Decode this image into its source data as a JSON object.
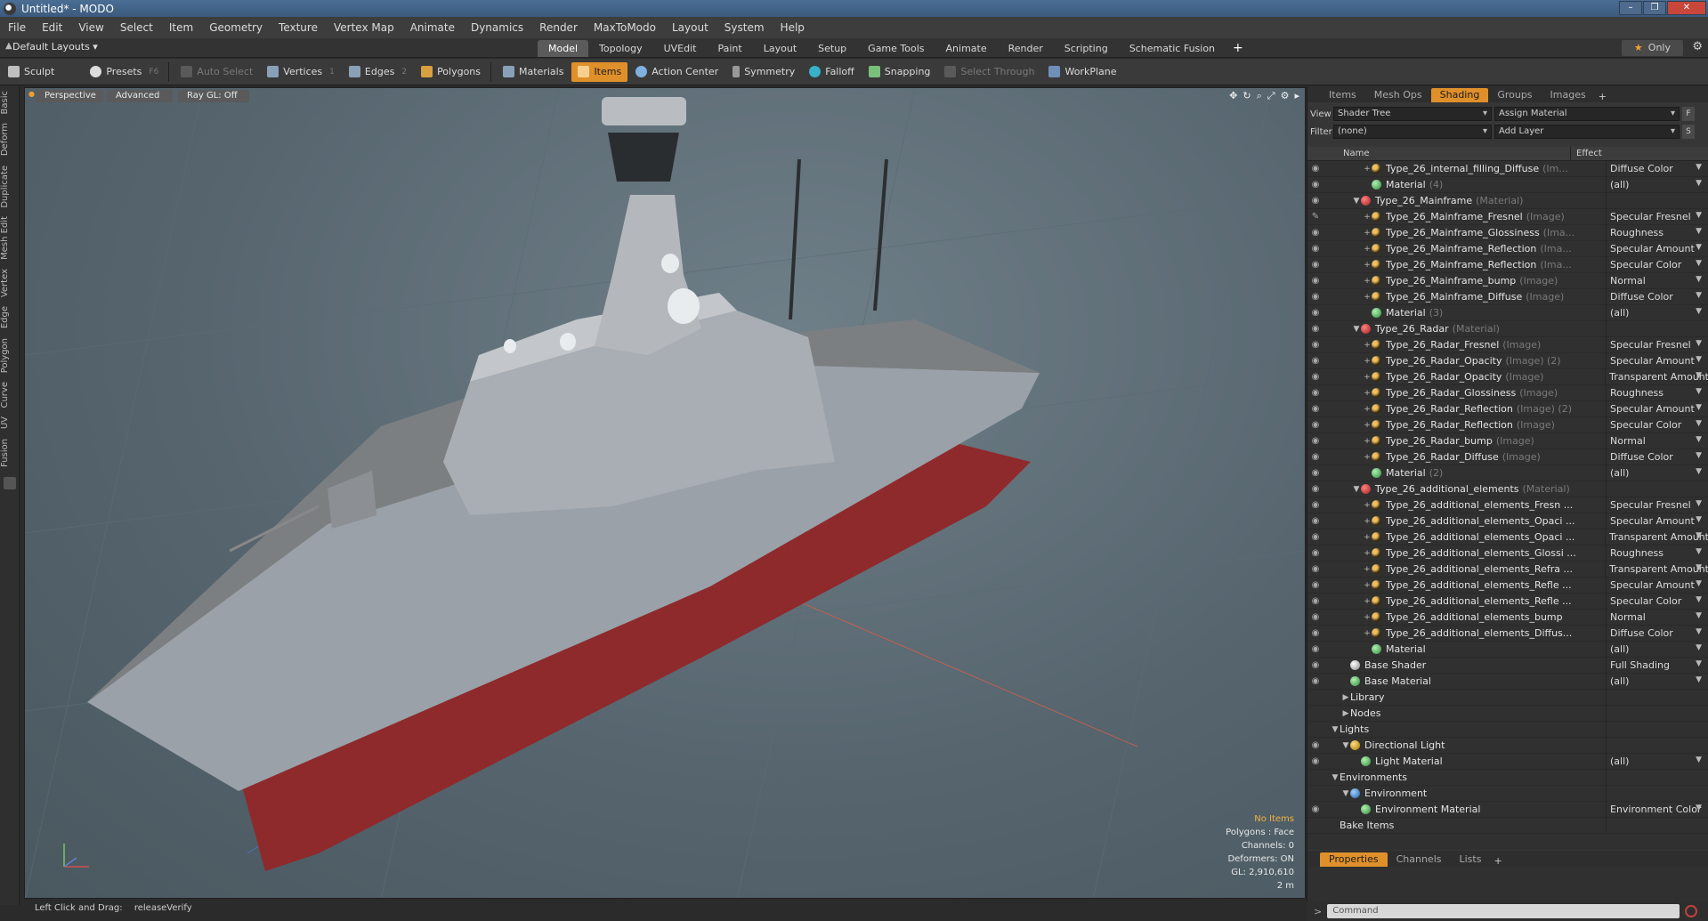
{
  "window": {
    "title": "Untitled* - MODO",
    "buttons": [
      "–",
      "❐",
      "✕"
    ]
  },
  "menu": [
    "File",
    "Edit",
    "View",
    "Select",
    "Item",
    "Geometry",
    "Texture",
    "Vertex Map",
    "Animate",
    "Dynamics",
    "Render",
    "MaxToModo",
    "Layout",
    "System",
    "Help"
  ],
  "layouts": {
    "selector": "Default Layouts ▾",
    "tabs": [
      "Model",
      "Topology",
      "UVEdit",
      "Paint",
      "Layout",
      "Setup",
      "Game Tools",
      "Animate",
      "Render",
      "Scripting",
      "Schematic Fusion"
    ],
    "active_tab": "Model",
    "only_label": "Only"
  },
  "toolbar": {
    "sculpt": "Sculpt",
    "presets": "Presets",
    "presets_key": "F6",
    "auto_select": "Auto Select",
    "vertices": "Vertices",
    "vertices_key": "1",
    "edges": "Edges",
    "edges_key": "2",
    "polygons": "Polygons",
    "materials": "Materials",
    "items": "Items",
    "action_center": "Action Center",
    "symmetry": "Symmetry",
    "falloff": "Falloff",
    "snapping": "Snapping",
    "select_through": "Select Through",
    "workplane": "WorkPlane"
  },
  "left_tabs": [
    "Basic",
    "Deform",
    "Duplicate",
    "Mesh Edit",
    "Vertex",
    "Edge",
    "Polygon",
    "Curve",
    "UV",
    "Fusion"
  ],
  "viewport": {
    "view": "Perspective",
    "shading": "Advanced",
    "raygl": "Ray GL: Off",
    "stats": {
      "items": "No Items",
      "polygons": "Polygons : Face",
      "channels": "Channels: 0",
      "deformers": "Deformers: ON",
      "gl": "GL: 2,910,610",
      "scale": "2 m"
    }
  },
  "status": {
    "hint": "Left Click and Drag:",
    "action": "releaseVerify"
  },
  "panel": {
    "tabs": [
      "Items",
      "Mesh Ops",
      "Shading",
      "Groups",
      "Images"
    ],
    "active_tab": "Shading",
    "view_label": "View",
    "view_value": "Shader Tree",
    "assign_material": "Assign Material",
    "filter_label": "Filter",
    "filter_value": "(none)",
    "add_layer": "Add Layer",
    "col_name": "Name",
    "col_effect": "Effect",
    "rows": [
      {
        "indent": 3,
        "exp": "+",
        "icon": "img",
        "name": "Type_26_internal_filling_Diffuse",
        "type": "(Im...",
        "effect": "Diffuse Color",
        "eye": true
      },
      {
        "indent": 3,
        "exp": "",
        "icon": "mat",
        "name": "Material",
        "type": "(4)",
        "effect": "(all)",
        "eye": true
      },
      {
        "indent": 2,
        "exp": "▼",
        "icon": "mask",
        "name": "Type_26_Mainframe",
        "type": "(Material)",
        "effect": "",
        "eye": true
      },
      {
        "indent": 3,
        "exp": "+",
        "icon": "img",
        "name": "Type_26_Mainframe_Fresnel",
        "type": "(Image)",
        "effect": "Specular Fresnel",
        "eye": true,
        "brush": true
      },
      {
        "indent": 3,
        "exp": "+",
        "icon": "img",
        "name": "Type_26_Mainframe_Glossiness",
        "type": "(Ima...",
        "effect": "Roughness",
        "eye": true
      },
      {
        "indent": 3,
        "exp": "+",
        "icon": "img",
        "name": "Type_26_Mainframe_Reflection",
        "type": "(Ima...",
        "effect": "Specular Amount",
        "eye": true
      },
      {
        "indent": 3,
        "exp": "+",
        "icon": "img",
        "name": "Type_26_Mainframe_Reflection",
        "type": "(Ima...",
        "effect": "Specular Color",
        "eye": true
      },
      {
        "indent": 3,
        "exp": "+",
        "icon": "img",
        "name": "Type_26_Mainframe_bump",
        "type": "(Image)",
        "effect": "Normal",
        "eye": true
      },
      {
        "indent": 3,
        "exp": "+",
        "icon": "img",
        "name": "Type_26_Mainframe_Diffuse",
        "type": "(Image)",
        "effect": "Diffuse Color",
        "eye": true
      },
      {
        "indent": 3,
        "exp": "",
        "icon": "mat",
        "name": "Material",
        "type": "(3)",
        "effect": "(all)",
        "eye": true
      },
      {
        "indent": 2,
        "exp": "▼",
        "icon": "mask",
        "name": "Type_26_Radar",
        "type": "(Material)",
        "effect": "",
        "eye": true
      },
      {
        "indent": 3,
        "exp": "+",
        "icon": "img",
        "name": "Type_26_Radar_Fresnel",
        "type": "(Image)",
        "effect": "Specular Fresnel",
        "eye": true
      },
      {
        "indent": 3,
        "exp": "+",
        "icon": "img",
        "name": "Type_26_Radar_Opacity",
        "type": "(Image) (2)",
        "effect": "Specular Amount",
        "eye": true
      },
      {
        "indent": 3,
        "exp": "+",
        "icon": "img",
        "name": "Type_26_Radar_Opacity",
        "type": "(Image)",
        "effect": "Transparent Amount",
        "eye": true
      },
      {
        "indent": 3,
        "exp": "+",
        "icon": "img",
        "name": "Type_26_Radar_Glossiness",
        "type": "(Image)",
        "effect": "Roughness",
        "eye": true
      },
      {
        "indent": 3,
        "exp": "+",
        "icon": "img",
        "name": "Type_26_Radar_Reflection",
        "type": "(Image) (2)",
        "effect": "Specular Amount",
        "eye": true
      },
      {
        "indent": 3,
        "exp": "+",
        "icon": "img",
        "name": "Type_26_Radar_Reflection",
        "type": "(Image)",
        "effect": "Specular Color",
        "eye": true
      },
      {
        "indent": 3,
        "exp": "+",
        "icon": "img",
        "name": "Type_26_Radar_bump",
        "type": "(Image)",
        "effect": "Normal",
        "eye": true
      },
      {
        "indent": 3,
        "exp": "+",
        "icon": "img",
        "name": "Type_26_Radar_Diffuse",
        "type": "(Image)",
        "effect": "Diffuse Color",
        "eye": true
      },
      {
        "indent": 3,
        "exp": "",
        "icon": "mat",
        "name": "Material",
        "type": "(2)",
        "effect": "(all)",
        "eye": true
      },
      {
        "indent": 2,
        "exp": "▼",
        "icon": "mask",
        "name": "Type_26_additional_elements",
        "type": "(Material)",
        "effect": "",
        "eye": true
      },
      {
        "indent": 3,
        "exp": "+",
        "icon": "img",
        "name": "Type_26_additional_elements_Fresn ...",
        "type": "",
        "effect": "Specular Fresnel",
        "eye": true
      },
      {
        "indent": 3,
        "exp": "+",
        "icon": "img",
        "name": "Type_26_additional_elements_Opaci ...",
        "type": "",
        "effect": "Specular Amount",
        "eye": true
      },
      {
        "indent": 3,
        "exp": "+",
        "icon": "img",
        "name": "Type_26_additional_elements_Opaci ...",
        "type": "",
        "effect": "Transparent Amount",
        "eye": true
      },
      {
        "indent": 3,
        "exp": "+",
        "icon": "img",
        "name": "Type_26_additional_elements_Glossi ...",
        "type": "",
        "effect": "Roughness",
        "eye": true
      },
      {
        "indent": 3,
        "exp": "+",
        "icon": "img",
        "name": "Type_26_additional_elements_Refra ...",
        "type": "",
        "effect": "Transparent Amount",
        "eye": true
      },
      {
        "indent": 3,
        "exp": "+",
        "icon": "img",
        "name": "Type_26_additional_elements_Refle ...",
        "type": "",
        "effect": "Specular Amount",
        "eye": true
      },
      {
        "indent": 3,
        "exp": "+",
        "icon": "img",
        "name": "Type_26_additional_elements_Refle ...",
        "type": "",
        "effect": "Specular Color",
        "eye": true
      },
      {
        "indent": 3,
        "exp": "+",
        "icon": "img",
        "name": "Type_26_additional_elements_bump",
        "type": "",
        "effect": "Normal",
        "eye": true
      },
      {
        "indent": 3,
        "exp": "+",
        "icon": "img",
        "name": "Type_26_additional_elements_Diffus...",
        "type": "",
        "effect": "Diffuse Color",
        "eye": true
      },
      {
        "indent": 3,
        "exp": "",
        "icon": "mat",
        "name": "Material",
        "type": "",
        "effect": "(all)",
        "eye": true
      },
      {
        "indent": 1,
        "exp": "",
        "icon": "base",
        "name": "Base Shader",
        "type": "",
        "effect": "Full Shading",
        "eye": true
      },
      {
        "indent": 1,
        "exp": "",
        "icon": "mat",
        "name": "Base Material",
        "type": "",
        "effect": "(all)",
        "eye": true
      },
      {
        "indent": 1,
        "exp": "▶",
        "icon": "",
        "name": "Library",
        "type": "",
        "effect": "",
        "eye": false
      },
      {
        "indent": 1,
        "exp": "▶",
        "icon": "",
        "name": "Nodes",
        "type": "",
        "effect": "",
        "eye": false
      },
      {
        "indent": 0,
        "exp": "▼",
        "icon": "",
        "name": "Lights",
        "type": "",
        "effect": "",
        "eye": false
      },
      {
        "indent": 1,
        "exp": "▼",
        "icon": "light",
        "name": "Directional Light",
        "type": "",
        "effect": "",
        "eye": true
      },
      {
        "indent": 2,
        "exp": "",
        "icon": "mat",
        "name": "Light Material",
        "type": "",
        "effect": "(all)",
        "eye": true
      },
      {
        "indent": 0,
        "exp": "▼",
        "icon": "",
        "name": "Environments",
        "type": "",
        "effect": "",
        "eye": false
      },
      {
        "indent": 1,
        "exp": "▼",
        "icon": "env",
        "name": "Environment",
        "type": "",
        "effect": "",
        "eye": false
      },
      {
        "indent": 2,
        "exp": "",
        "icon": "mat",
        "name": "Environment Material",
        "type": "",
        "effect": "Environment Color",
        "eye": true
      },
      {
        "indent": 0,
        "exp": "",
        "icon": "",
        "name": "Bake Items",
        "type": "",
        "effect": "",
        "eye": false
      }
    ],
    "bottom_tabs": [
      "Properties",
      "Channels",
      "Lists"
    ],
    "bottom_active": "Properties",
    "command_placeholder": "Command"
  }
}
